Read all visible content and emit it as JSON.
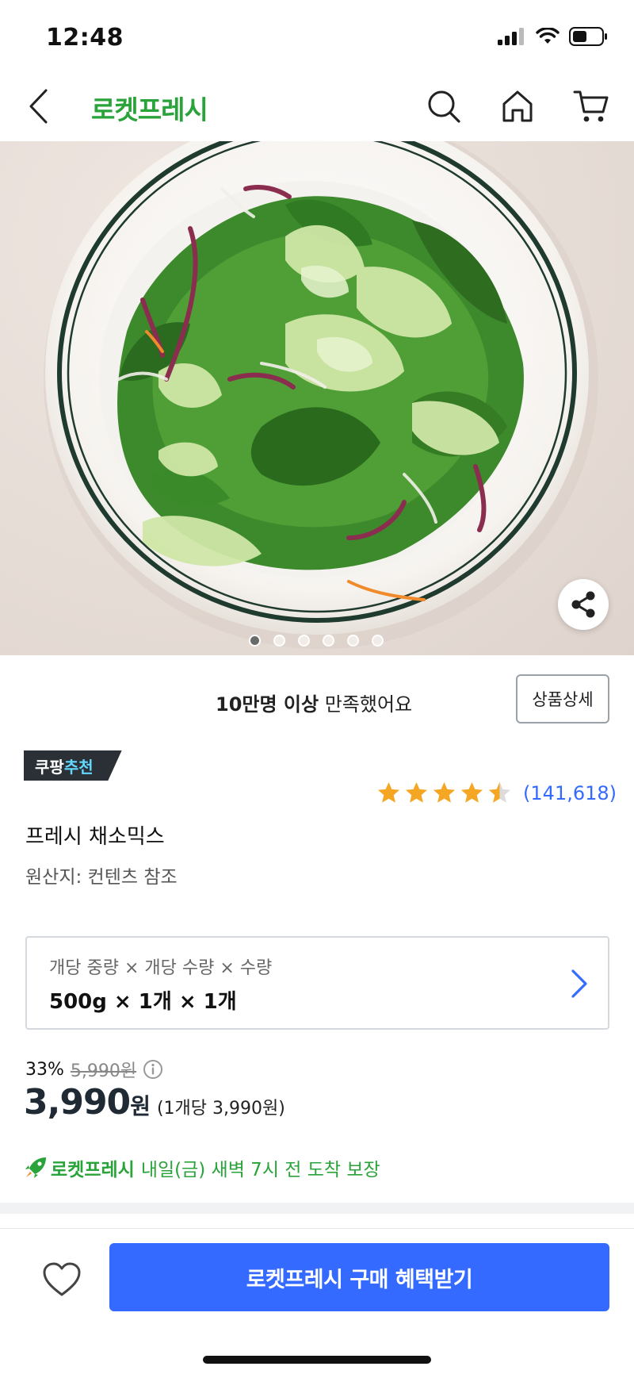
{
  "status_bar": {
    "time": "12:48"
  },
  "header": {
    "brand": "로켓프레시"
  },
  "gallery": {
    "total_images": 6,
    "active_index": 0
  },
  "satisfaction": {
    "highlight": "10만명 이상",
    "text": "만족했어요",
    "detail_button": "상품상세"
  },
  "badge": {
    "prefix": "쿠팡",
    "accent": "추천"
  },
  "rating": {
    "stars": 4.5,
    "count": "(141,618)"
  },
  "product": {
    "title": "프레시 채소믹스",
    "origin": "원산지: 컨텐츠 참조"
  },
  "option": {
    "label": "개당 중량 × 개당 수량 × 수량",
    "value": "500g × 1개 × 1개"
  },
  "price": {
    "discount": "33%",
    "original": "5,990원",
    "amount": "3,990",
    "currency": "원",
    "per_unit": "(1개당 3,990원)"
  },
  "delivery": {
    "brand": "로켓프레시",
    "text": "내일(금) 새벽 7시 전 도착 보장"
  },
  "cta": {
    "buy_label": "로켓프레시 구매 혜택받기"
  },
  "colors": {
    "brand_green": "#2aa33a",
    "accent_blue": "#346aff",
    "star": "#f5a623"
  }
}
